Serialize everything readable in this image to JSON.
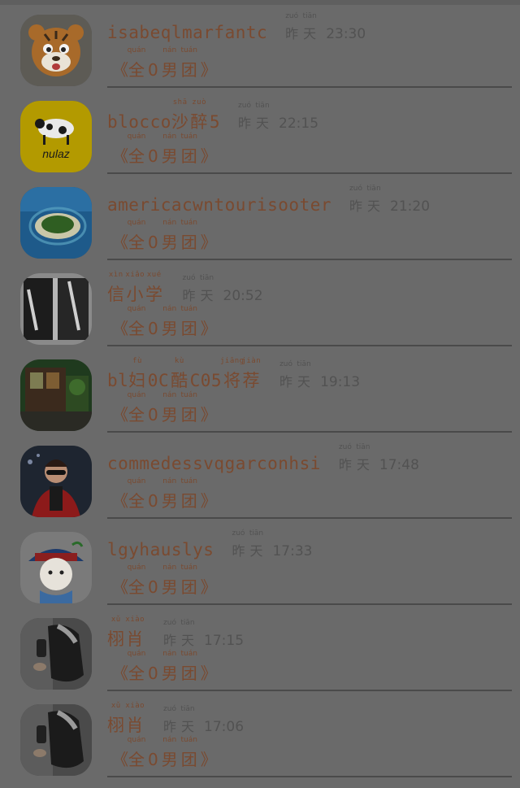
{
  "rows": [
    {
      "name": "isabeqlmarfantc",
      "date_pinyin": [
        "zuó",
        "tiān"
      ],
      "date_chars": [
        "昨",
        "天"
      ],
      "time": "23:30",
      "group": {
        "open": "《",
        "close": "》",
        "chars": [
          "全",
          "0",
          "男",
          "团"
        ],
        "pinyin": [
          "quán",
          "",
          "nán",
          "tuán"
        ]
      },
      "avatar_icon": "tiger-avatar"
    },
    {
      "name": "blocco",
      "name_suffix_chars": [
        "沙",
        "醉"
      ],
      "name_suffix_pinyin": [
        "shā",
        "zuò"
      ],
      "name_tail": "5",
      "date_pinyin": [
        "zuó",
        "tiān"
      ],
      "date_chars": [
        "昨",
        "天"
      ],
      "time": "22:15",
      "group": {
        "open": "《",
        "close": "》",
        "chars": [
          "全",
          "0",
          "男",
          "团"
        ],
        "pinyin": [
          "quán",
          "",
          "nán",
          "tuán"
        ]
      },
      "avatar_icon": "nulaz-cow-avatar",
      "avatar_text": "nulaz"
    },
    {
      "name": "americacwntourisooter",
      "date_pinyin": [
        "zuó",
        "tiān"
      ],
      "date_chars": [
        "昨",
        "天"
      ],
      "time": "21:20",
      "group": {
        "open": "《",
        "close": "》",
        "chars": [
          "全",
          "0",
          "男",
          "团"
        ],
        "pinyin": [
          "quán",
          "",
          "nán",
          "tuán"
        ]
      },
      "avatar_icon": "island-avatar"
    },
    {
      "name_chars": [
        "信",
        "小",
        "学"
      ],
      "name_pinyin": [
        "xìn",
        "xiǎo",
        "xué"
      ],
      "date_pinyin": [
        "zuó",
        "tiān"
      ],
      "date_chars": [
        "昨",
        "天"
      ],
      "time": "20:52",
      "group": {
        "open": "《",
        "close": "》",
        "chars": [
          "全",
          "0",
          "男",
          "团"
        ],
        "pinyin": [
          "quán",
          "",
          "nán",
          "tuán"
        ]
      },
      "avatar_icon": "jackets-avatar"
    },
    {
      "name": "bl",
      "name_mid_chars": [
        "妇",
        "0C",
        "酷",
        "C05",
        "将",
        "荐"
      ],
      "name_mid_pinyin": [
        "fù",
        "",
        "kù",
        "",
        "jiāng",
        "jiàn"
      ],
      "date_pinyin": [
        "zuó",
        "tiān"
      ],
      "date_chars": [
        "昨",
        "天"
      ],
      "time": "19:13",
      "group": {
        "open": "《",
        "close": "》",
        "chars": [
          "全",
          "0",
          "男",
          "团"
        ],
        "pinyin": [
          "quán",
          "",
          "nán",
          "tuán"
        ]
      },
      "avatar_icon": "storefront-avatar"
    },
    {
      "name": "commedessvqgarconhsi",
      "date_pinyin": [
        "zuó",
        "tiān"
      ],
      "date_chars": [
        "昨",
        "天"
      ],
      "time": "17:48",
      "group": {
        "open": "《",
        "close": "》",
        "chars": [
          "全",
          "0",
          "男",
          "团"
        ],
        "pinyin": [
          "quán",
          "",
          "nán",
          "tuán"
        ]
      },
      "avatar_icon": "man-red-jacket-avatar"
    },
    {
      "name": "lgyhauslys",
      "date_pinyin": [
        "zuó",
        "tiān"
      ],
      "date_chars": [
        "昨",
        "天"
      ],
      "time": "17:33",
      "group": {
        "open": "《",
        "close": "》",
        "chars": [
          "全",
          "0",
          "男",
          "团"
        ],
        "pinyin": [
          "quán",
          "",
          "nán",
          "tuán"
        ]
      },
      "avatar_icon": "cartoon-official-avatar"
    },
    {
      "name_chars": [
        "栩",
        "肖"
      ],
      "name_pinyin": [
        "xǔ",
        "xiào"
      ],
      "date_pinyin": [
        "zuó",
        "tiān"
      ],
      "date_chars": [
        "昨",
        "天"
      ],
      "time": "17:15",
      "group": {
        "open": "《",
        "close": "》",
        "chars": [
          "全",
          "0",
          "男",
          "团"
        ],
        "pinyin": [
          "quán",
          "",
          "nán",
          "tuán"
        ]
      },
      "avatar_icon": "mirror-selfie-avatar"
    },
    {
      "name_chars": [
        "栩",
        "肖"
      ],
      "name_pinyin": [
        "xǔ",
        "xiào"
      ],
      "date_pinyin": [
        "zuó",
        "tiān"
      ],
      "date_chars": [
        "昨",
        "天"
      ],
      "time": "17:06",
      "group": {
        "open": "《",
        "close": "》",
        "chars": [
          "全",
          "0",
          "男",
          "团"
        ],
        "pinyin": [
          "quán",
          "",
          "nán",
          "tuán"
        ]
      },
      "avatar_icon": "mirror-selfie-avatar"
    }
  ]
}
